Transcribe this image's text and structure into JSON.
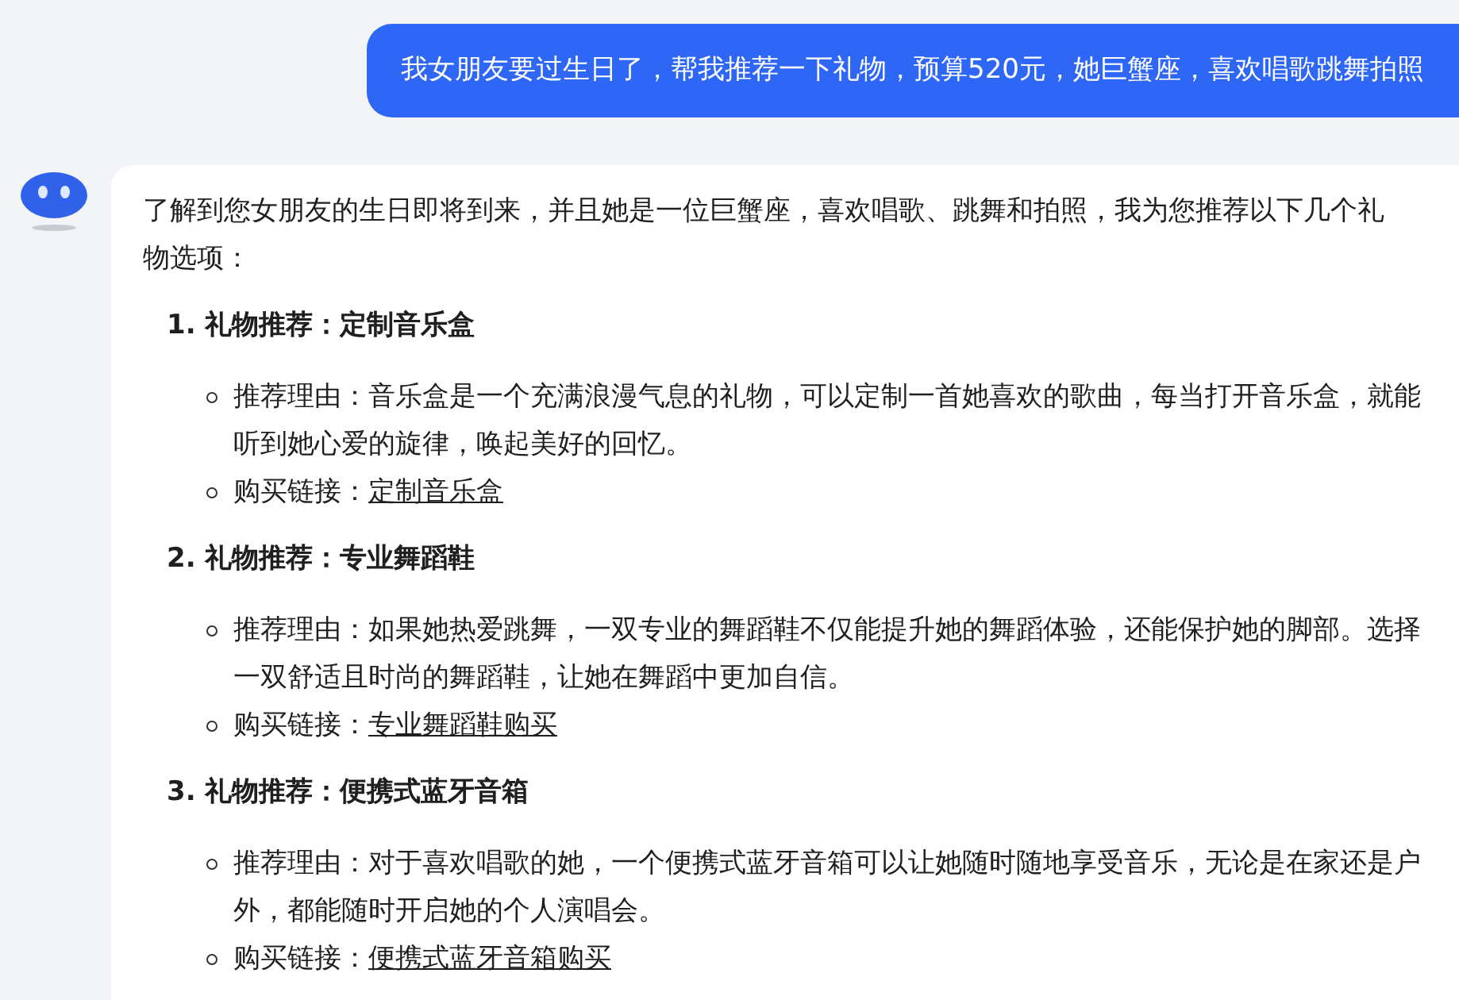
{
  "user_message": "我女朋友要过生日了，帮我推荐一下礼物，预算520元，她巨蟹座，喜欢唱歌跳舞拍照",
  "reply": {
    "intro": "了解到您女朋友的生日即将到来，并且她是一位巨蟹座，喜欢唱歌、跳舞和拍照，我为您推荐以下几个礼物选项：",
    "gifts": [
      {
        "number": "1.",
        "title": "礼物推荐：定制音乐盒",
        "reason_label": "推荐理由：",
        "reason": "音乐盒是一个充满浪漫气息的礼物，可以定制一首她喜欢的歌曲，每当打开音乐盒，就能听到她心爱的旋律，唤起美好的回忆。",
        "link_label": "购买链接：",
        "link": "定制音乐盒"
      },
      {
        "number": "2.",
        "title": "礼物推荐：专业舞蹈鞋",
        "reason_label": "推荐理由：",
        "reason": "如果她热爱跳舞，一双专业的舞蹈鞋不仅能提升她的舞蹈体验，还能保护她的脚部。选择一双舒适且时尚的舞蹈鞋，让她在舞蹈中更加自信。",
        "link_label": "购买链接：",
        "link": "专业舞蹈鞋购买"
      },
      {
        "number": "3.",
        "title": "礼物推荐：便携式蓝牙音箱",
        "reason_label": "推荐理由：",
        "reason": "对于喜欢唱歌的她，一个便携式蓝牙音箱可以让她随时随地享受音乐，无论是在家还是户外，都能随时开启她的个人演唱会。",
        "link_label": "购买链接：",
        "link": "便携式蓝牙音箱购买"
      }
    ]
  }
}
